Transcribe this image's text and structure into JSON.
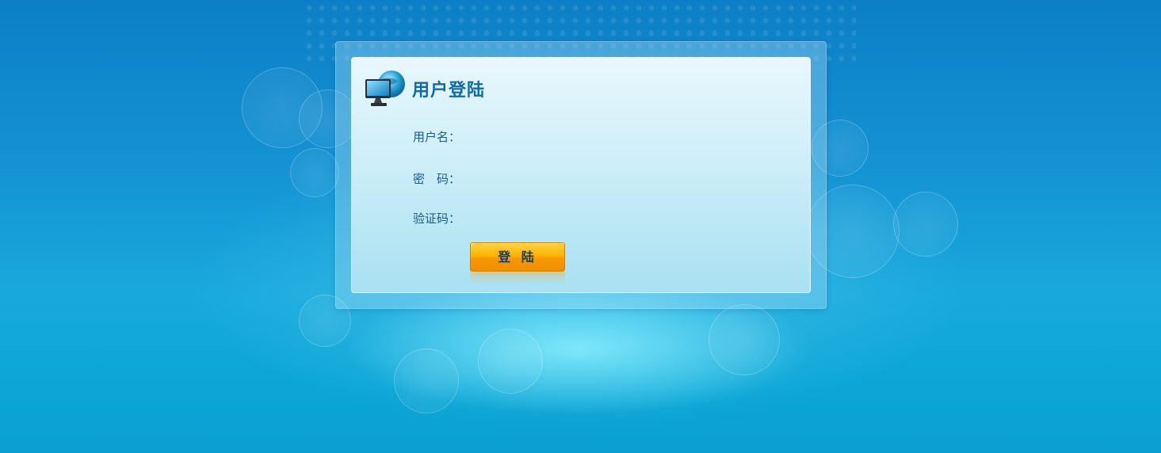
{
  "login": {
    "title": "用户登陆",
    "username_label": "用户名：",
    "username_value": "",
    "password_label": "密　码：",
    "password_value": "",
    "captcha_label": "验证码：",
    "captcha_value": "",
    "submit_label": "登 陆"
  },
  "icons": {
    "logo": "computer-globe-icon"
  },
  "colors": {
    "background_top": "#0c7fc6",
    "background_bottom": "#0b9fd0",
    "title": "#0f6aa8",
    "label": "#1a5a8f",
    "button": "#ffb400",
    "button_text": "#0e3d73"
  }
}
